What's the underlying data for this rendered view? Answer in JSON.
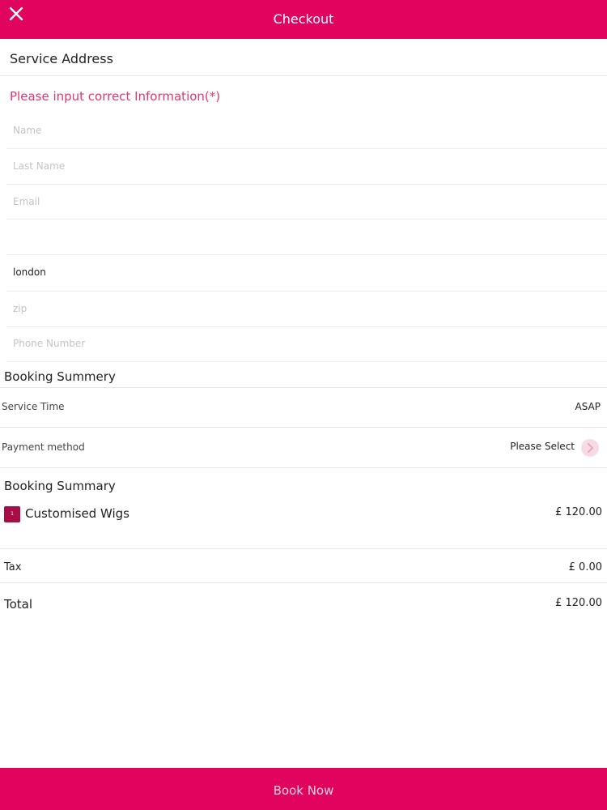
{
  "header": {
    "title": "Checkout",
    "close_icon": "close-icon"
  },
  "service_address": {
    "title": "Service Address"
  },
  "form": {
    "hint": "Please input correct Information(*)",
    "name_placeholder": "Name",
    "last_name_placeholder": "Last Name",
    "email_placeholder": "Email",
    "address_value": "",
    "city_value": "london",
    "zip_placeholder": "zip",
    "phone_placeholder": "Phone Number"
  },
  "booking_summery": {
    "title": "Booking Summery",
    "service_time_label": "Service Time",
    "service_time_value": "ASAP",
    "payment_label": "Payment method",
    "payment_value": "Please Select"
  },
  "booking_summary": {
    "title": "Booking Summary",
    "item": {
      "qty": "1",
      "name": "Customised Wigs",
      "price": "£ 120.00"
    },
    "tax_label": "Tax",
    "tax_value": "£ 0.00",
    "total_label": "Total",
    "total_value": "£ 120.00"
  },
  "footer": {
    "book_label": "Book Now"
  },
  "colors": {
    "accent": "#e0045f",
    "hint": "#e0386f",
    "badge": "#a80d46"
  }
}
